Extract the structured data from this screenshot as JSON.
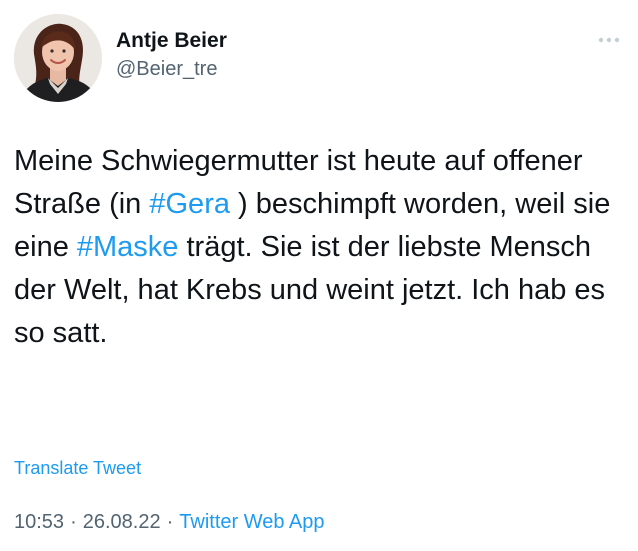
{
  "tweet": {
    "author": {
      "display_name": "Antje Beier",
      "handle": "@Beier_tre"
    },
    "more_icon": "more-horizontal-icon",
    "text_parts": {
      "p1": "Meine Schwiegermutter ist heute auf offener Straße (in ",
      "hashtag1": "#Gera",
      "p2": " ) beschimpft worden, weil sie eine ",
      "hashtag2": "#Maske",
      "p3": " trägt. Sie ist der liebste Mensch der Welt, hat Krebs und weint jetzt. Ich hab es so satt."
    },
    "translate_label": "Translate Tweet",
    "time": "10:53",
    "separator": "·",
    "date": "26.08.22",
    "source": "Twitter Web App",
    "colors": {
      "link": "#1d9bf0",
      "text": "#0f1419",
      "muted": "#536471"
    }
  }
}
